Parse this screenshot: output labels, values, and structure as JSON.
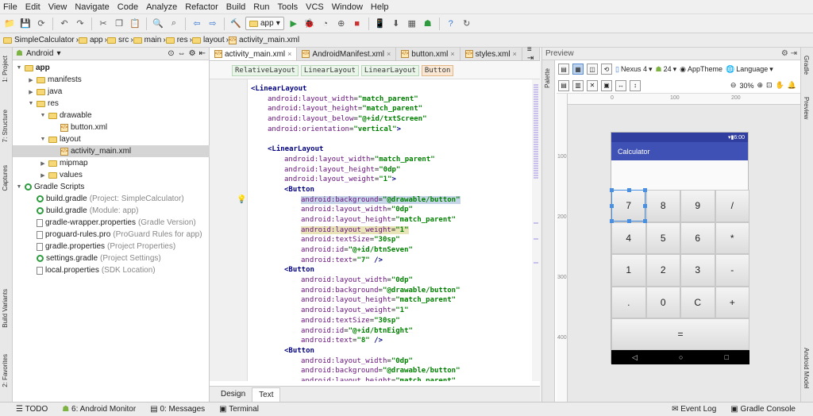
{
  "menu": [
    "File",
    "Edit",
    "View",
    "Navigate",
    "Code",
    "Analyze",
    "Refactor",
    "Build",
    "Run",
    "Tools",
    "VCS",
    "Window",
    "Help"
  ],
  "toolbar": {
    "run_config": "app"
  },
  "breadcrumb": [
    "SimpleCalculator",
    "app",
    "src",
    "main",
    "res",
    "layout",
    "activity_main.xml"
  ],
  "project": {
    "view_mode": "Android",
    "tree": [
      {
        "label": "app",
        "depth": 0,
        "kind": "module",
        "open": true
      },
      {
        "label": "manifests",
        "depth": 1,
        "kind": "folder",
        "open": false
      },
      {
        "label": "java",
        "depth": 1,
        "kind": "folder",
        "open": false
      },
      {
        "label": "res",
        "depth": 1,
        "kind": "folder",
        "open": true
      },
      {
        "label": "drawable",
        "depth": 2,
        "kind": "folder",
        "open": true
      },
      {
        "label": "button.xml",
        "depth": 3,
        "kind": "xml"
      },
      {
        "label": "layout",
        "depth": 2,
        "kind": "folder",
        "open": true
      },
      {
        "label": "activity_main.xml",
        "depth": 3,
        "kind": "xml",
        "selected": true
      },
      {
        "label": "mipmap",
        "depth": 2,
        "kind": "folder",
        "open": false
      },
      {
        "label": "values",
        "depth": 2,
        "kind": "folder",
        "open": false
      },
      {
        "label": "Gradle Scripts",
        "depth": 0,
        "kind": "gradle",
        "open": true
      },
      {
        "label": "build.gradle",
        "hint": "(Project: SimpleCalculator)",
        "depth": 1,
        "kind": "gradle"
      },
      {
        "label": "build.gradle",
        "hint": "(Module: app)",
        "depth": 1,
        "kind": "gradle"
      },
      {
        "label": "gradle-wrapper.properties",
        "hint": "(Gradle Version)",
        "depth": 1,
        "kind": "file"
      },
      {
        "label": "proguard-rules.pro",
        "hint": "(ProGuard Rules for app)",
        "depth": 1,
        "kind": "file"
      },
      {
        "label": "gradle.properties",
        "hint": "(Project Properties)",
        "depth": 1,
        "kind": "file"
      },
      {
        "label": "settings.gradle",
        "hint": "(Project Settings)",
        "depth": 1,
        "kind": "gradle"
      },
      {
        "label": "local.properties",
        "hint": "(SDK Location)",
        "depth": 1,
        "kind": "file"
      }
    ]
  },
  "left_tabs": [
    "1: Project",
    "7: Structure",
    "Captures",
    "Build Variants",
    "2: Favorites"
  ],
  "right_tabs": [
    "Gradle",
    "Preview",
    "Android Model"
  ],
  "editor": {
    "tabs": [
      "activity_main.xml",
      "AndroidManifest.xml",
      "button.xml",
      "styles.xml"
    ],
    "tag_path": [
      "RelativeLayout",
      "LinearLayout",
      "LinearLayout",
      "Button"
    ],
    "lines": [
      {
        "i": 0,
        "parts": [
          [
            "tg",
            "<LinearLayout"
          ]
        ]
      },
      {
        "i": 1,
        "parts": [
          [
            "ns",
            "android:"
          ],
          [
            "at",
            "layout_width"
          ],
          [
            "p",
            "="
          ],
          [
            "vl",
            "\"match_parent\""
          ]
        ]
      },
      {
        "i": 1,
        "parts": [
          [
            "ns",
            "android:"
          ],
          [
            "at",
            "layout_height"
          ],
          [
            "p",
            "="
          ],
          [
            "vl",
            "\"match_parent\""
          ]
        ]
      },
      {
        "i": 1,
        "parts": [
          [
            "ns",
            "android:"
          ],
          [
            "at",
            "layout_below"
          ],
          [
            "p",
            "="
          ],
          [
            "vl",
            "\"@+id/txtScreen\""
          ]
        ]
      },
      {
        "i": 1,
        "parts": [
          [
            "ns",
            "android:"
          ],
          [
            "at",
            "orientation"
          ],
          [
            "p",
            "="
          ],
          [
            "vl",
            "\"vertical\""
          ],
          [
            "tg",
            ">"
          ]
        ]
      },
      {
        "i": 0,
        "parts": []
      },
      {
        "i": 1,
        "parts": [
          [
            "tg",
            "<LinearLayout"
          ]
        ]
      },
      {
        "i": 2,
        "parts": [
          [
            "ns",
            "android:"
          ],
          [
            "at",
            "layout_width"
          ],
          [
            "p",
            "="
          ],
          [
            "vl",
            "\"match_parent\""
          ]
        ]
      },
      {
        "i": 2,
        "parts": [
          [
            "ns",
            "android:"
          ],
          [
            "at",
            "layout_height"
          ],
          [
            "p",
            "="
          ],
          [
            "vl",
            "\"0dp\""
          ]
        ]
      },
      {
        "i": 2,
        "parts": [
          [
            "ns",
            "android:"
          ],
          [
            "at",
            "layout_weight"
          ],
          [
            "p",
            "="
          ],
          [
            "vl",
            "\"1\""
          ],
          [
            "tg",
            ">"
          ]
        ]
      },
      {
        "i": 2,
        "parts": [
          [
            "tg",
            "<Button"
          ]
        ]
      },
      {
        "i": 3,
        "sel": true,
        "parts": [
          [
            "ns",
            "android:"
          ],
          [
            "at",
            "background"
          ],
          [
            "p",
            "="
          ],
          [
            "vl",
            "\"@drawable/button\""
          ]
        ]
      },
      {
        "i": 3,
        "parts": [
          [
            "ns",
            "android:"
          ],
          [
            "at",
            "layout_width"
          ],
          [
            "p",
            "="
          ],
          [
            "vl",
            "\"0dp\""
          ]
        ]
      },
      {
        "i": 3,
        "parts": [
          [
            "ns",
            "android:"
          ],
          [
            "at",
            "layout_height"
          ],
          [
            "p",
            "="
          ],
          [
            "vl",
            "\"match_parent\""
          ]
        ]
      },
      {
        "i": 3,
        "hl": true,
        "parts": [
          [
            "ns",
            "android:"
          ],
          [
            "at",
            "layout_weight"
          ],
          [
            "p",
            "="
          ],
          [
            "vl",
            "\"1\""
          ]
        ]
      },
      {
        "i": 3,
        "parts": [
          [
            "ns",
            "android:"
          ],
          [
            "at",
            "textSize"
          ],
          [
            "p",
            "="
          ],
          [
            "vl",
            "\"30sp\""
          ]
        ]
      },
      {
        "i": 3,
        "parts": [
          [
            "ns",
            "android:"
          ],
          [
            "at",
            "id"
          ],
          [
            "p",
            "="
          ],
          [
            "vl",
            "\"@+id/btnSeven\""
          ]
        ]
      },
      {
        "i": 3,
        "parts": [
          [
            "ns",
            "android:"
          ],
          [
            "at",
            "text"
          ],
          [
            "p",
            "="
          ],
          [
            "vl",
            "\"7\""
          ],
          [
            "tg",
            " />"
          ]
        ]
      },
      {
        "i": 2,
        "parts": [
          [
            "tg",
            "<Button"
          ]
        ]
      },
      {
        "i": 3,
        "parts": [
          [
            "ns",
            "android:"
          ],
          [
            "at",
            "layout_width"
          ],
          [
            "p",
            "="
          ],
          [
            "vl",
            "\"0dp\""
          ]
        ]
      },
      {
        "i": 3,
        "parts": [
          [
            "ns",
            "android:"
          ],
          [
            "at",
            "background"
          ],
          [
            "p",
            "="
          ],
          [
            "vl",
            "\"@drawable/button\""
          ]
        ]
      },
      {
        "i": 3,
        "parts": [
          [
            "ns",
            "android:"
          ],
          [
            "at",
            "layout_height"
          ],
          [
            "p",
            "="
          ],
          [
            "vl",
            "\"match_parent\""
          ]
        ]
      },
      {
        "i": 3,
        "parts": [
          [
            "ns",
            "android:"
          ],
          [
            "at",
            "layout_weight"
          ],
          [
            "p",
            "="
          ],
          [
            "vl",
            "\"1\""
          ]
        ]
      },
      {
        "i": 3,
        "parts": [
          [
            "ns",
            "android:"
          ],
          [
            "at",
            "textSize"
          ],
          [
            "p",
            "="
          ],
          [
            "vl",
            "\"30sp\""
          ]
        ]
      },
      {
        "i": 3,
        "parts": [
          [
            "ns",
            "android:"
          ],
          [
            "at",
            "id"
          ],
          [
            "p",
            "="
          ],
          [
            "vl",
            "\"@+id/btnEight\""
          ]
        ]
      },
      {
        "i": 3,
        "parts": [
          [
            "ns",
            "android:"
          ],
          [
            "at",
            "text"
          ],
          [
            "p",
            "="
          ],
          [
            "vl",
            "\"8\""
          ],
          [
            "tg",
            " />"
          ]
        ]
      },
      {
        "i": 2,
        "parts": [
          [
            "tg",
            "<Button"
          ]
        ]
      },
      {
        "i": 3,
        "parts": [
          [
            "ns",
            "android:"
          ],
          [
            "at",
            "layout_width"
          ],
          [
            "p",
            "="
          ],
          [
            "vl",
            "\"0dp\""
          ]
        ]
      },
      {
        "i": 3,
        "parts": [
          [
            "ns",
            "android:"
          ],
          [
            "at",
            "background"
          ],
          [
            "p",
            "="
          ],
          [
            "vl",
            "\"@drawable/button\""
          ]
        ]
      },
      {
        "i": 3,
        "parts": [
          [
            "ns",
            "android:"
          ],
          [
            "at",
            "layout_height"
          ],
          [
            "p",
            "="
          ],
          [
            "vl",
            "\"match_parent\""
          ]
        ]
      }
    ],
    "bottom_tabs": [
      "Design",
      "Text"
    ],
    "active_bottom": "Text"
  },
  "preview": {
    "title": "Preview",
    "palette_label": "Palette",
    "device": "Nexus 4",
    "api": "24",
    "theme": "AppTheme",
    "language": "Language",
    "zoom": "30%",
    "ruler": [
      "0",
      "100",
      "200"
    ],
    "ruler_v": [
      "100",
      "200",
      "300",
      "400"
    ],
    "phone": {
      "status_time": "6:00",
      "app_title": "Calculator",
      "keys": [
        "7",
        "8",
        "9",
        "/",
        "4",
        "5",
        "6",
        "*",
        "1",
        "2",
        "3",
        "-",
        ".",
        "0",
        "C",
        "+"
      ],
      "equals": "=",
      "nav": [
        "◁",
        "○",
        "□"
      ]
    }
  },
  "status": {
    "left": [
      "TODO",
      "6: Android Monitor",
      "0: Messages",
      "Terminal"
    ],
    "right": [
      "Event Log",
      "Gradle Console"
    ]
  },
  "colors": {
    "primary": "#3f51b5",
    "primary_dark": "#303f9f"
  }
}
